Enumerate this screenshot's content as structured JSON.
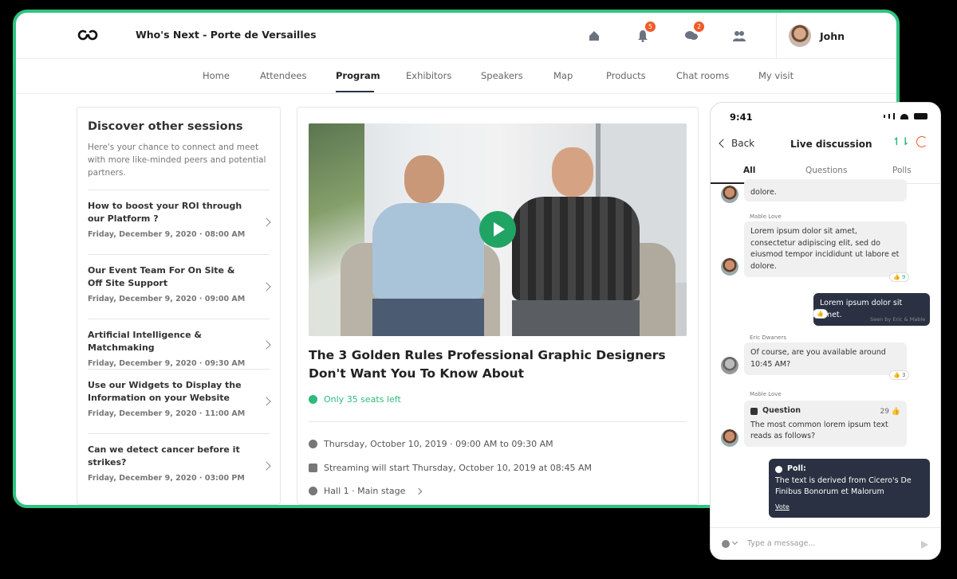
{
  "header": {
    "event_title": "Who's Next - Porte de Versailles",
    "notifications_badge": "5",
    "messages_badge": "2",
    "user_name": "John"
  },
  "nav": {
    "items": [
      "Home",
      "Attendees",
      "Program",
      "Exhibitors",
      "Speakers",
      "Map",
      "Products",
      "Chat rooms",
      "My visit"
    ],
    "active": "Program"
  },
  "sidebar": {
    "title": "Discover other sessions",
    "description": "Here's your chance to connect and meet with more like-minded peers and potential partners.",
    "sessions": [
      {
        "title": "How to boost your ROI through our Platform ?",
        "date": "Friday, December 9, 2020 · 08:00 AM"
      },
      {
        "title": "Our Event Team For On Site & Off Site Support",
        "date": "Friday, December 9, 2020 · 09:00 AM"
      },
      {
        "title": "Artificial Intelligence & Matchmaking",
        "date": "Friday, December 9, 2020 · 09:30 AM"
      },
      {
        "title": "Use our Widgets to Display the Information on your Website",
        "date": "Friday, December 9, 2020 · 11:00 AM"
      },
      {
        "title": "Can we detect cancer before it strikes?",
        "date": "Friday, December 9, 2020 · 03:00 PM"
      }
    ]
  },
  "main": {
    "title": "The 3 Golden Rules Professional Graphic Designers Don't Want You To Know About",
    "seats": "Only 35 seats left",
    "datetime": "Thursday, October 10, 2019 · 09:00 AM to 09:30 AM",
    "streaming": "Streaming will start Thursday, October 10, 2019 at 08:45 AM",
    "location": "Hall 1 · Main stage"
  },
  "phone": {
    "time": "9:41",
    "back_label": "Back",
    "title": "Live discussion",
    "tabs": [
      "All",
      "Questions",
      "Polls"
    ],
    "messages": {
      "m0_text": "dolore.",
      "m1_author": "Mable Love",
      "m1_text": "Lorem ipsum dolor sit amet, consectetur adipiscing elit, sed do eiusmod tempor incididunt ut labore et dolore.",
      "m1_reaction": "9",
      "m2_text": "Lorem ipsum dolor sit amet.",
      "m2_seen": "Seen by Eric & Mable",
      "m3_author": "Eric Dwaners",
      "m3_text": "Of course, are you available around 10:45 AM?",
      "m3_reaction": "3",
      "m4_author": "Mable Love",
      "m4_label": "Question",
      "m4_count": "29",
      "m4_text": "The most common lorem ipsum text reads as follows?",
      "m5_label": "Poll:",
      "m5_text": "The text is derived from Cicero's De Finibus Bonorum et Malorum",
      "m5_vote": "Vote"
    },
    "input_placeholder": "Type a message..."
  },
  "colors": {
    "accent_green": "#2fb97a",
    "frame_green": "#2fc37f",
    "badge_orange": "#f05a28",
    "dark_bubble": "#2a3142"
  }
}
